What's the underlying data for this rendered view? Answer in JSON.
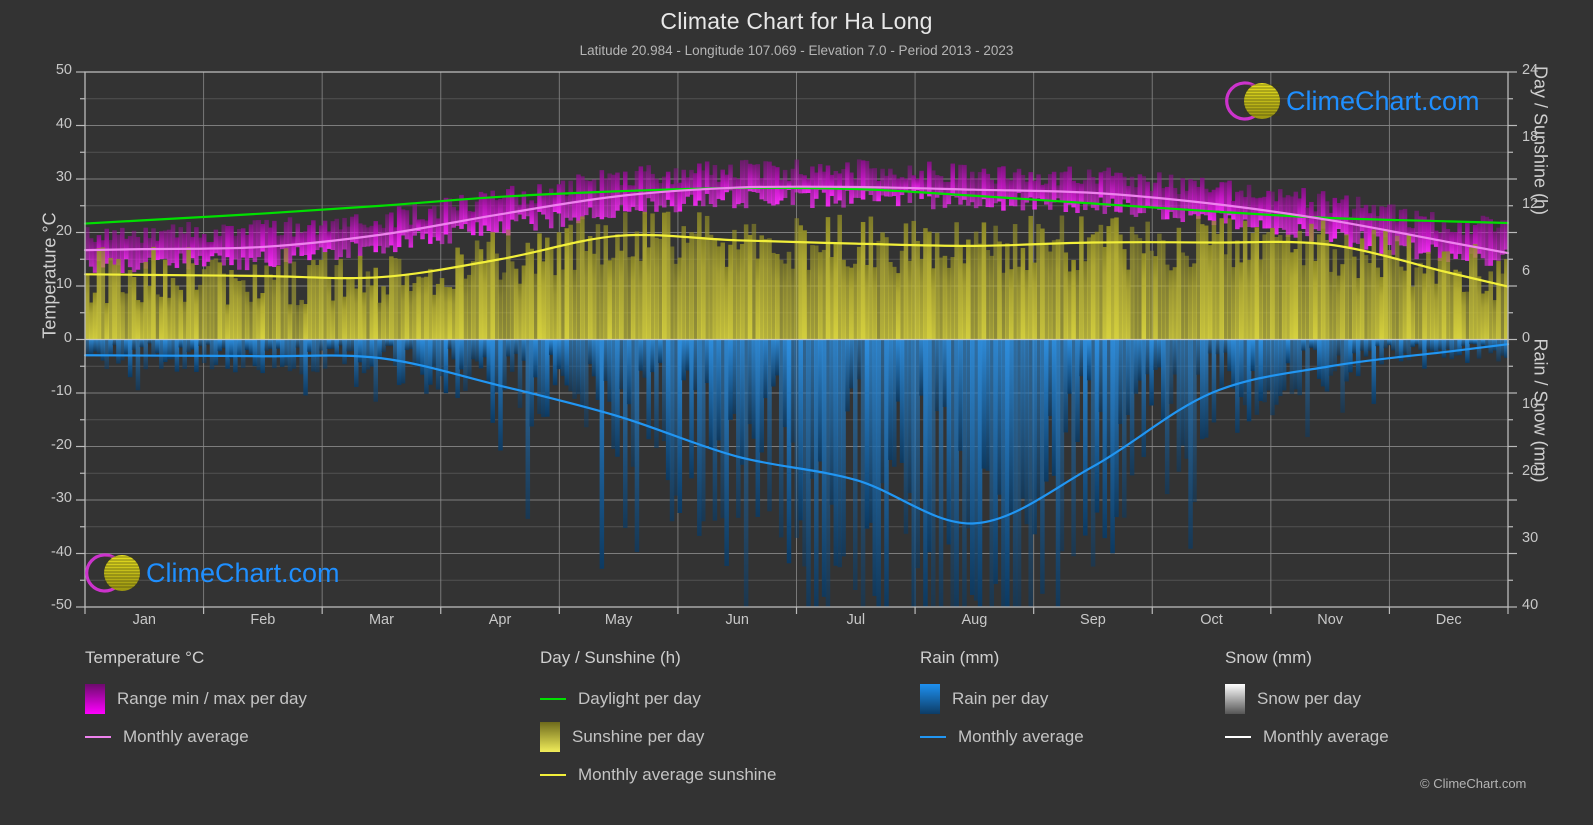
{
  "header": {
    "title": "Climate Chart for Ha Long",
    "subtitle": "Latitude 20.984 - Longitude 107.069 - Elevation 7.0 - Period 2013 - 2023"
  },
  "axes": {
    "left_label": "Temperature °C",
    "right_top_label": "Day / Sunshine (h)",
    "right_bottom_label": "Rain / Snow (mm)",
    "left_ticks": [
      "50",
      "40",
      "30",
      "20",
      "10",
      "0",
      "-10",
      "-20",
      "-30",
      "-40",
      "-50"
    ],
    "right_top_ticks": [
      "24",
      "18",
      "12",
      "6",
      "0"
    ],
    "right_bottom_ticks": [
      "0",
      "10",
      "20",
      "30",
      "40"
    ],
    "x_ticks": [
      "Jan",
      "Feb",
      "Mar",
      "Apr",
      "May",
      "Jun",
      "Jul",
      "Aug",
      "Sep",
      "Oct",
      "Nov",
      "Dec"
    ]
  },
  "legend": {
    "columns": [
      {
        "heading": "Temperature °C",
        "items": [
          {
            "label": "Range min / max per day",
            "marker": "swatch",
            "color": "#ff00ff"
          },
          {
            "label": "Monthly average",
            "marker": "line",
            "color": "#ee82ee"
          }
        ]
      },
      {
        "heading": "Day / Sunshine (h)",
        "items": [
          {
            "label": "Daylight per day",
            "marker": "line",
            "color": "#00e000"
          },
          {
            "label": "Sunshine per day",
            "marker": "swatch",
            "color": "#ece94a"
          },
          {
            "label": "Monthly average sunshine",
            "marker": "line",
            "color": "#f2ef3a"
          }
        ]
      },
      {
        "heading": "Rain (mm)",
        "items": [
          {
            "label": "Rain per day",
            "marker": "swatch",
            "color": "#0e87e8"
          },
          {
            "label": "Monthly average",
            "marker": "line",
            "color": "#2196f3"
          }
        ]
      },
      {
        "heading": "Snow (mm)",
        "items": [
          {
            "label": "Snow per day",
            "marker": "swatch",
            "color": "#f2f2f2"
          },
          {
            "label": "Monthly average",
            "marker": "line",
            "color": "#ffffff"
          }
        ]
      }
    ]
  },
  "watermark": {
    "text": "ClimeChart.com",
    "arc_color": "#cc33cc",
    "sphere_color": "#d4cc18",
    "text_color": "#1f8fff"
  },
  "footer": {
    "copyright": "© ClimeChart.com"
  },
  "colors": {
    "background": "#333333",
    "grid": "#777777",
    "axis": "#bbbbbb",
    "temp_range": "#c915c9",
    "temp_avg": "#ee82ee",
    "daylight": "#00e000",
    "sunshine_fill": "#b3ad33",
    "sunshine_avg": "#f2ef3a",
    "rain_fill": "#1063a8",
    "rain_avg": "#2196f3"
  },
  "chart_data": {
    "type": "area",
    "title": "Climate Chart for Ha Long",
    "subtitle": "Latitude 20.984 - Longitude 107.069 - Elevation 7.0 - Period 2013 - 2023",
    "xlabel": "",
    "ylabel": "Temperature °C",
    "ylim": [
      -50,
      50
    ],
    "y2_top_label": "Day / Sunshine (h)",
    "y2_top_lim": [
      0,
      24
    ],
    "y2_bottom_label": "Rain / Snow (mm)",
    "y2_bottom_lim": [
      0,
      40
    ],
    "grid": true,
    "legend_position": "below",
    "categories": [
      "Jan",
      "Feb",
      "Mar",
      "Apr",
      "May",
      "Jun",
      "Jul",
      "Aug",
      "Sep",
      "Oct",
      "Nov",
      "Dec"
    ],
    "series": [
      {
        "name": "Monthly average temperature",
        "unit": "°C",
        "axis": "left",
        "color": "#ee82ee",
        "values": [
          16.9,
          17.3,
          19.6,
          23.4,
          26.8,
          28.4,
          28.5,
          28.0,
          27.4,
          25.4,
          22.3,
          18.2
        ]
      },
      {
        "name": "Daily min temperature",
        "unit": "°C",
        "axis": "left",
        "color": "#c915c9",
        "values": [
          14.2,
          14.8,
          17.3,
          21.0,
          24.4,
          26.2,
          26.4,
          26.0,
          25.2,
          22.9,
          19.5,
          15.5
        ]
      },
      {
        "name": "Daily max temperature",
        "unit": "°C",
        "axis": "left",
        "color": "#c915c9",
        "values": [
          20.0,
          20.3,
          22.5,
          26.4,
          30.2,
          31.6,
          31.7,
          31.0,
          30.4,
          28.5,
          25.6,
          21.6
        ]
      },
      {
        "name": "Daylight per day",
        "unit": "h",
        "axis": "right-top",
        "color": "#00e000",
        "values": [
          10.7,
          11.3,
          12.0,
          12.8,
          13.3,
          13.6,
          13.5,
          12.9,
          12.2,
          11.5,
          10.9,
          10.6
        ]
      },
      {
        "name": "Monthly average sunshine",
        "unit": "h",
        "axis": "right-top",
        "color": "#f2ef3a",
        "values": [
          5.8,
          5.7,
          5.6,
          7.2,
          9.3,
          8.9,
          8.6,
          8.4,
          8.7,
          8.7,
          8.5,
          6.0
        ]
      },
      {
        "name": "Monthly average rain",
        "unit": "mm",
        "axis": "right-bottom",
        "color": "#2196f3",
        "values": [
          2.4,
          2.5,
          2.8,
          6.9,
          11.5,
          17.5,
          21.0,
          27.5,
          19.0,
          8.0,
          4.0,
          1.8
        ]
      },
      {
        "name": "Monthly average snow",
        "unit": "mm",
        "axis": "right-bottom",
        "color": "#ffffff",
        "values": [
          0,
          0,
          0,
          0,
          0,
          0,
          0,
          0,
          0,
          0,
          0,
          0
        ]
      }
    ]
  }
}
